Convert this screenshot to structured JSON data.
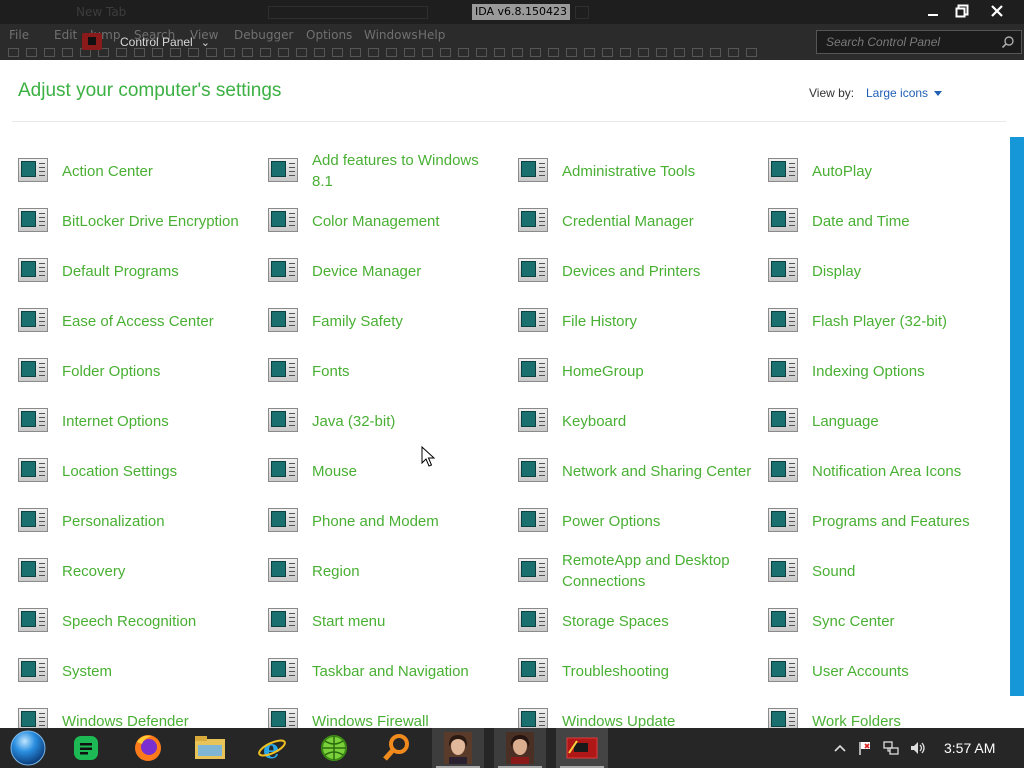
{
  "window": {
    "app_title": "IDA v6.8.150423",
    "ghost_tab": "New Tab",
    "menu": [
      "File",
      "Edit",
      "Jump",
      "Search",
      "View",
      "Debugger",
      "Options",
      "Windows",
      "Help"
    ]
  },
  "nav": {
    "breadcrumb": "Control Panel",
    "search_placeholder": "Search Control Panel"
  },
  "header": {
    "title": "Adjust your computer's settings",
    "view_by_label": "View by:",
    "view_by_value": "Large icons"
  },
  "items": [
    "Action Center",
    "Add features to Windows 8.1",
    "Administrative Tools",
    "AutoPlay",
    "BitLocker Drive Encryption",
    "Color Management",
    "Credential Manager",
    "Date and Time",
    "Default Programs",
    "Device Manager",
    "Devices and Printers",
    "Display",
    "Ease of Access Center",
    "Family Safety",
    "File History",
    "Flash Player (32-bit)",
    "Folder Options",
    "Fonts",
    "HomeGroup",
    "Indexing Options",
    "Internet Options",
    "Java (32-bit)",
    "Keyboard",
    "Language",
    "Location Settings",
    "Mouse",
    "Network and Sharing Center",
    "Notification Area Icons",
    "Personalization",
    "Phone and Modem",
    "Power Options",
    "Programs and Features",
    "Recovery",
    "Region",
    "RemoteApp and Desktop Connections",
    "Sound",
    "Speech Recognition",
    "Start menu",
    "Storage Spaces",
    "Sync Center",
    "System",
    "Taskbar and Navigation",
    "Troubleshooting",
    "User Accounts",
    "Windows Defender",
    "Windows Firewall",
    "Windows Update",
    "Work Folders"
  ],
  "taskbar": {
    "apps": [
      "start-orb",
      "sheets",
      "firefox",
      "file-explorer",
      "internet-explorer",
      "globe",
      "search",
      "portrait",
      "portrait",
      "ida"
    ],
    "tray_icons": [
      "chevron-up-icon",
      "action-center-flag-icon",
      "network-icon",
      "volume-icon"
    ],
    "clock": "3:57 AM"
  },
  "colors": {
    "accent_green": "#49b034",
    "title_green": "#3cb043",
    "link_blue": "#1f5fb4",
    "scrollbar": "#1597d8",
    "titlebar": "#1e1e1e",
    "taskbar": "#262626"
  }
}
